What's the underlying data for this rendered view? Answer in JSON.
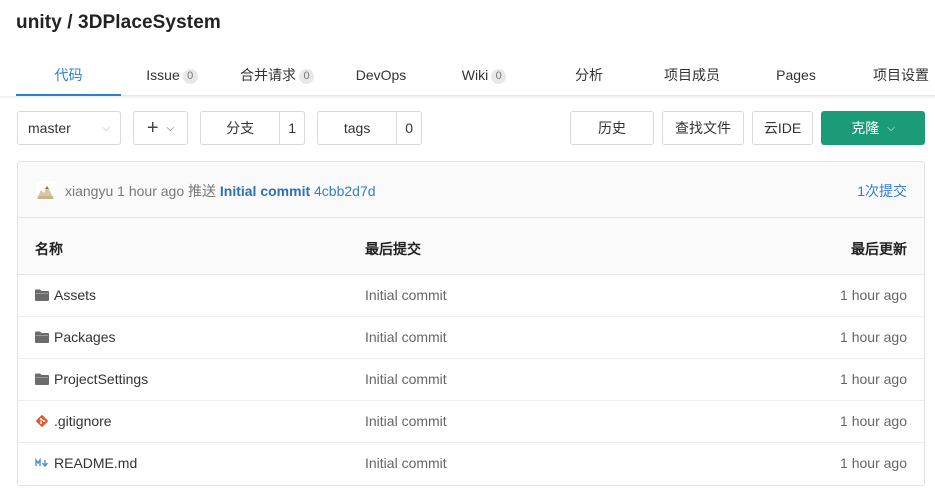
{
  "repo": {
    "title": "unity / 3DPlaceSystem"
  },
  "tabs": [
    {
      "label": "代码",
      "badge": null,
      "active": true
    },
    {
      "label": "Issue",
      "badge": "0"
    },
    {
      "label": "合并请求",
      "badge": "0"
    },
    {
      "label": "DevOps",
      "badge": null
    },
    {
      "label": "Wiki",
      "badge": "0"
    },
    {
      "label": "分析",
      "badge": null
    },
    {
      "label": "项目成员",
      "badge": null
    },
    {
      "label": "Pages",
      "badge": null
    },
    {
      "label": "项目设置",
      "badge": null
    }
  ],
  "toolbar": {
    "branch": "master",
    "branches_label": "分支",
    "branches_count": "1",
    "tags_label": "tags",
    "tags_count": "0",
    "history_label": "历史",
    "find_file_label": "查找文件",
    "ide_label": "云IDE",
    "clone_label": "克隆"
  },
  "last_commit": {
    "author": "xiangyu",
    "time": "1 hour ago",
    "action": "推送",
    "message": "Initial commit",
    "hash": "4cbb2d7d",
    "count_label": "1次提交"
  },
  "table": {
    "headers": {
      "name": "名称",
      "commit": "最后提交",
      "updated": "最后更新"
    },
    "rows": [
      {
        "icon": "folder-icon",
        "name": "Assets",
        "commit": "Initial commit",
        "time": "1 hour ago"
      },
      {
        "icon": "folder-icon",
        "name": "Packages",
        "commit": "Initial commit",
        "time": "1 hour ago"
      },
      {
        "icon": "folder-icon",
        "name": "ProjectSettings",
        "commit": "Initial commit",
        "time": "1 hour ago"
      },
      {
        "icon": "git-file-icon",
        "name": ".gitignore",
        "commit": "Initial commit",
        "time": "1 hour ago"
      },
      {
        "icon": "markdown-file-icon",
        "name": "README.md",
        "commit": "Initial commit",
        "time": "1 hour ago"
      }
    ]
  },
  "colors": {
    "accent": "#2f7fd0",
    "clone": "#1c9b79",
    "git": "#e05c2e",
    "markdown": "#4a90d9"
  }
}
